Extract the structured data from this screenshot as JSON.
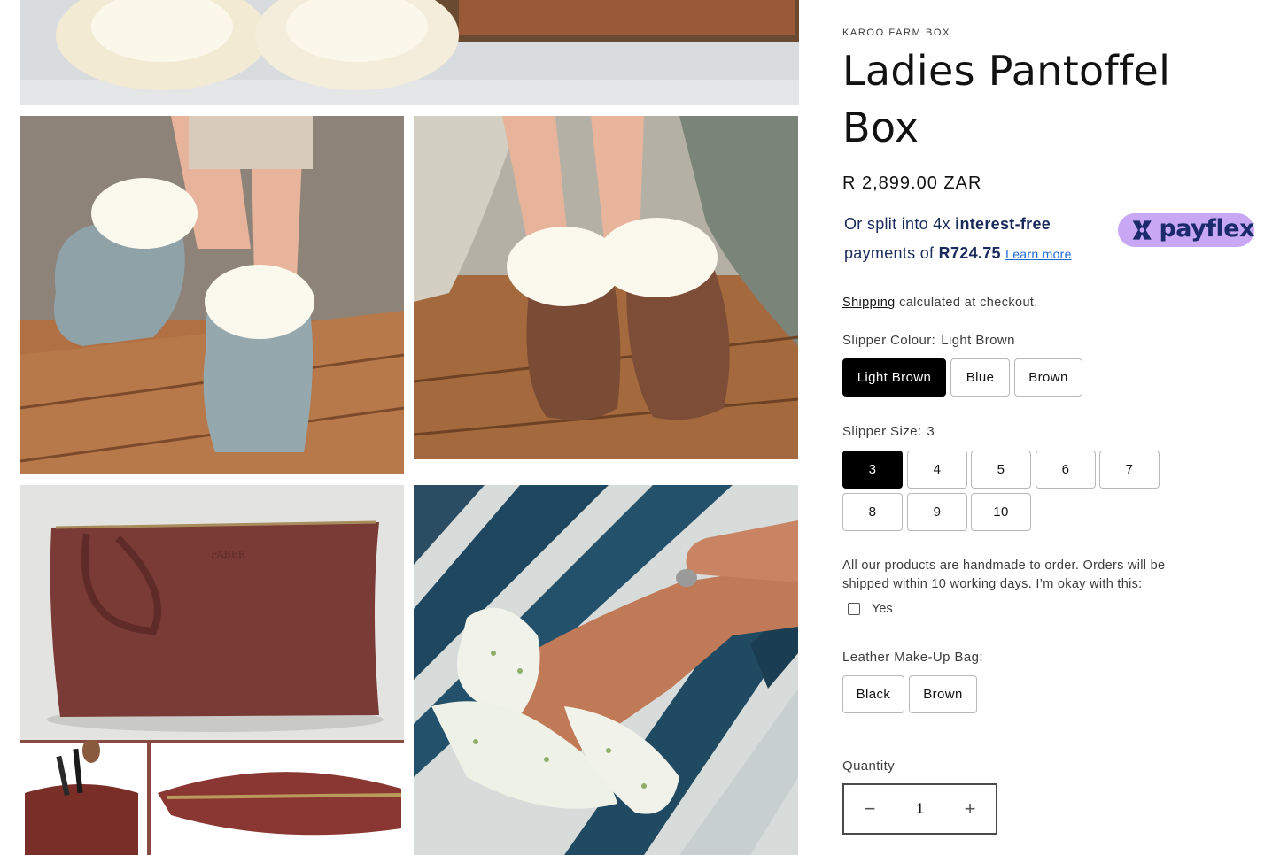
{
  "product": {
    "vendor": "KAROO FARM BOX",
    "title": "Ladies Pantoffel Box",
    "price": "R 2,899.00 ZAR"
  },
  "payflex": {
    "line1_prefix": "Or split into 4x ",
    "line1_bold": "interest-free",
    "line2_prefix": "payments of ",
    "installment": "R724.75",
    "learn_more": "Learn more",
    "logo_text": "payflex",
    "logo_color": "#c8a8f5"
  },
  "shipping": {
    "link_text": "Shipping",
    "suffix": " calculated at checkout."
  },
  "colour_option": {
    "label": "Slipper Colour:",
    "selected": "Light Brown",
    "values": [
      "Light Brown",
      "Blue",
      "Brown"
    ]
  },
  "size_option": {
    "label": "Slipper Size:",
    "selected": "3",
    "values": [
      "3",
      "4",
      "5",
      "6",
      "7",
      "8",
      "9",
      "10"
    ]
  },
  "handmade_notice": {
    "text": "All our products are handmade to order. Orders will be shipped within 10 working days. I’m okay with this:",
    "checkbox_label": "Yes",
    "checked": false
  },
  "bag_option": {
    "label": "Leather Make-Up Bag:",
    "values": [
      "Black",
      "Brown"
    ]
  },
  "quantity": {
    "label": "Quantity",
    "value": "1",
    "minus": "−",
    "plus": "+"
  },
  "gallery": {
    "images": [
      "slippers-top-image",
      "blue-slippers-image",
      "brown-slippers-image",
      "makeup-bag-image",
      "bag-details-image",
      "scrunchie-image"
    ]
  },
  "brand_text_on_bag": "FABER"
}
